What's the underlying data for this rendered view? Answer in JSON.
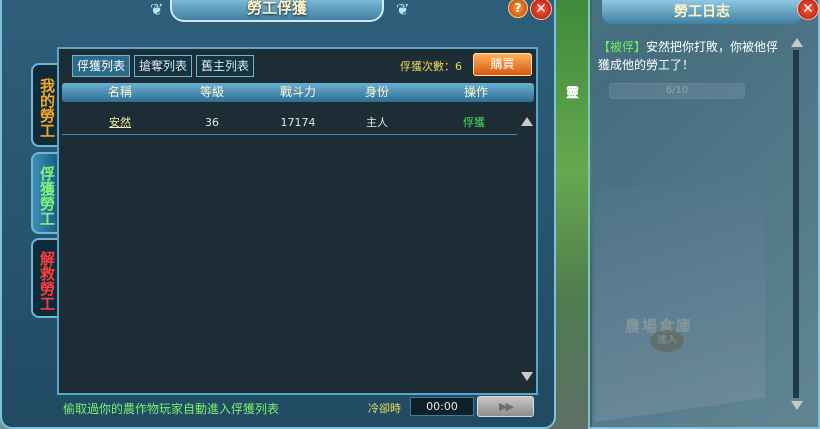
{
  "main_window": {
    "title": "勞工俘獲",
    "help_label": "?",
    "close_label": "✕"
  },
  "side_tabs": [
    {
      "label": "我的勞工",
      "color": "#f5a623"
    },
    {
      "label": "俘獲勞工",
      "color": "#7cf37a"
    },
    {
      "label": "解救勞工",
      "color": "#ff3b3b"
    }
  ],
  "sub_tabs": [
    {
      "label": "俘獲列表",
      "active": true
    },
    {
      "label": "搶奪列表",
      "active": false
    },
    {
      "label": "舊主列表",
      "active": false
    }
  ],
  "capture_count_label": "俘獲次數：6",
  "buy_button_label": "購買",
  "table": {
    "headers": [
      "名稱",
      "等級",
      "戰斗力",
      "身份",
      "操作"
    ],
    "rows": [
      {
        "name": "安然",
        "level": "36",
        "power": "17174",
        "identity": "主人",
        "action": "俘獲"
      }
    ]
  },
  "bottom_hint": "偷取過你的農作物玩家自動進入俘獲列表",
  "cooldown_label": "冷卻時",
  "cooldown_time": "00:00",
  "cooldown_button": "▶▶",
  "log_panel": {
    "title": "勞工日志",
    "close_label": "✕",
    "entry_tag": "【被俘】",
    "entry_text": "安然把你打敗，你被他俘獲成他的勞工了！"
  },
  "background": {
    "ghost_label": "靈",
    "ghost_bar": "6/10",
    "building_label": "農場倉庫",
    "enter_label": "進入"
  }
}
